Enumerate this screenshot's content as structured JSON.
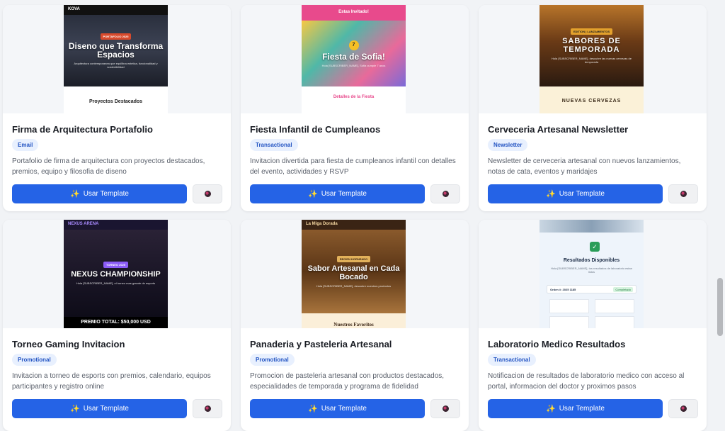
{
  "use_button_label": "Usar Template",
  "templates": [
    {
      "title": "Firma de Arquitectura Portafolio",
      "badge": "Email",
      "description": "Portafolio de firma de arquitectura con proyectos destacados, premios, equipo y filosofia de diseno",
      "preview": {
        "brand": "KOVA",
        "chip": "PORTAFOLIO 2025",
        "headline": "Diseno que Transforma Espacios",
        "subline": "Arquitectura contemporanea que equilibra estetica, funcionalidad y sostenibilidad",
        "section": "Proyectos Destacados"
      }
    },
    {
      "title": "Fiesta Infantil de Cumpleanos",
      "badge": "Transactional",
      "description": "Invitacion divertida para fiesta de cumpleanos infantil con detalles del evento, actividades y RSVP",
      "preview": {
        "brand": "Estas Invitado!",
        "chip": "7",
        "headline": "Fiesta de Sofia!",
        "subline": "Hola [SUBSCRIBER_NAME], Sofia cumple 7 anos",
        "section": "Detalles de la Fiesta"
      }
    },
    {
      "title": "Cerveceria Artesanal Newsletter",
      "badge": "Newsletter",
      "description": "Newsletter de cerveceria artesanal con nuevos lanzamientos, notas de cata, eventos y maridajes",
      "preview": {
        "brand": "",
        "chip": "EDITION | LANZAMIENTOS",
        "headline": "SABORES DE TEMPORADA",
        "subline": "Hola [SUBSCRIBER_NAME], descubre las nuevas cervezas de temporada",
        "section": "NUEVAS CERVEZAS"
      }
    },
    {
      "title": "Torneo Gaming Invitacion",
      "badge": "Promotional",
      "description": "Invitacion a torneo de esports con premios, calendario, equipos participantes y registro online",
      "preview": {
        "brand": "NEXUS ARENA",
        "chip": "TORNEO 2025",
        "headline": "NEXUS CHAMPIONSHIP",
        "subline": "Hola [SUBSCRIBER_NAME], el torneo mas grande de esports",
        "section": "PREMIO TOTAL: $50,000 USD"
      }
    },
    {
      "title": "Panaderia y Pasteleria Artesanal",
      "badge": "Promotional",
      "description": "Promocion de pasteleria artesanal con productos destacados, especialidades de temporada y programa de fidelidad",
      "preview": {
        "brand": "La Miga Dorada",
        "chip": "RECIEN HORNEADO",
        "headline": "Sabor Artesanal en Cada Bocado",
        "subline": "Hola [SUBSCRIBER_NAME], descubre nuestros productos",
        "section": "Nuestros Favoritos"
      }
    },
    {
      "title": "Laboratorio Medico Resultados",
      "badge": "Transactional",
      "description": "Notificacion de resultados de laboratorio medico con acceso al portal, informacion del doctor y proximos pasos",
      "preview": {
        "brand": "",
        "chip": "Completado",
        "headline": "Resultados Disponibles",
        "subline": "Hola [SUBSCRIBER_NAME], tus resultados de laboratorio estan listos",
        "section": "Orden #: 2025 1185"
      }
    }
  ]
}
